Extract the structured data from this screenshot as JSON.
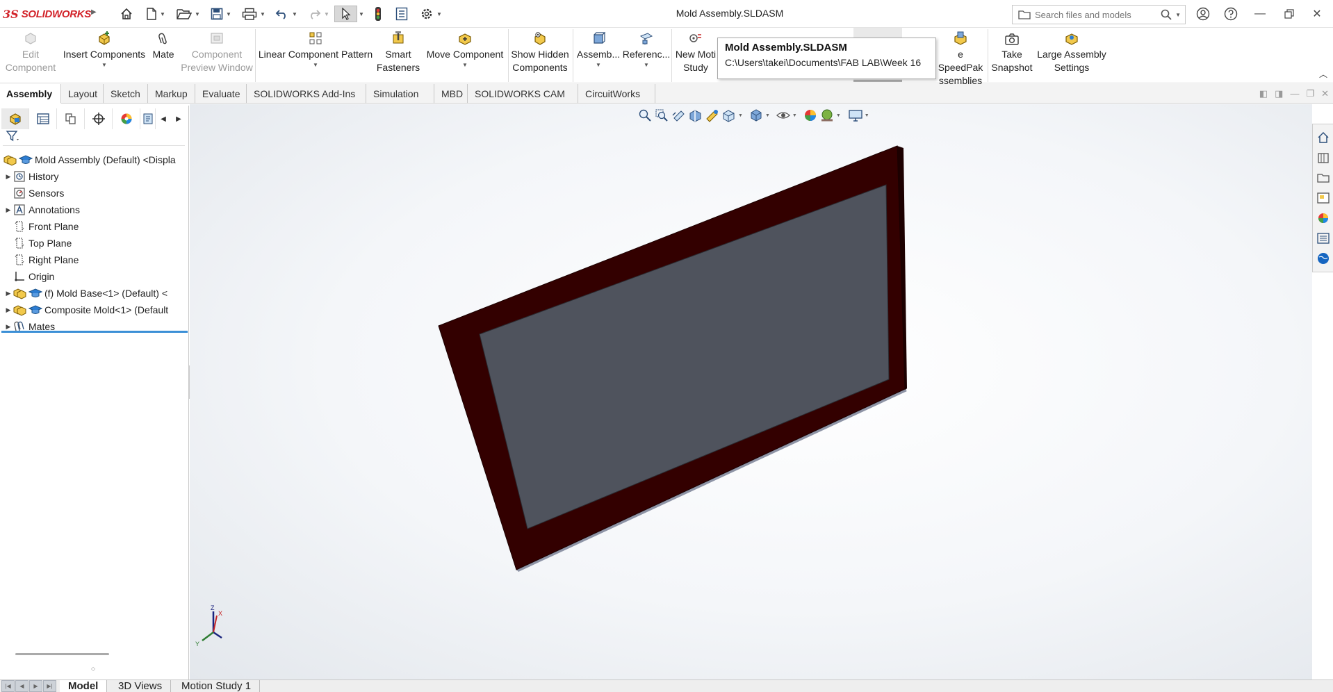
{
  "app": {
    "brand": "SOLIDWORKS"
  },
  "titlebar": {
    "document_title": "Mold Assembly.SLDASM"
  },
  "search": {
    "placeholder": "Search files and models"
  },
  "commands": {
    "edit_component": "Edit\nComponent",
    "insert_components": "Insert Components",
    "mate": "Mate",
    "component_preview": "Component\nPreview Window",
    "linear_pattern": "Linear Component Pattern",
    "smart_fasteners": "Smart\nFasteners",
    "move_component": "Move Component",
    "show_hidden": "Show Hidden\nComponents",
    "assembly": "Assemb...",
    "reference": "Referenc...",
    "new_motion": "New Moti\nStudy",
    "speedpak": "e SpeedPak\nssemblies",
    "take_snapshot": "Take\nSnapshot",
    "large_assembly": "Large Assembly\nSettings"
  },
  "tooltip": {
    "title": "Mold Assembly.SLDASM",
    "path": "C:\\Users\\takei\\Documents\\FAB LAB\\Week 16"
  },
  "tabs": [
    {
      "label": "Assembly"
    },
    {
      "label": "Layout"
    },
    {
      "label": "Sketch"
    },
    {
      "label": "Markup"
    },
    {
      "label": "Evaluate"
    },
    {
      "label": "SOLIDWORKS Add-Ins"
    },
    {
      "label": "Simulation"
    },
    {
      "label": "MBD"
    },
    {
      "label": "SOLIDWORKS CAM"
    },
    {
      "label": "CircuitWorks"
    }
  ],
  "tree": {
    "root": "Mold Assembly (Default) <Displa",
    "history": "History",
    "sensors": "Sensors",
    "annotations": "Annotations",
    "front_plane": "Front Plane",
    "top_plane": "Top Plane",
    "right_plane": "Right Plane",
    "origin": "Origin",
    "mold_base": "(f) Mold Base<1> (Default) <",
    "composite_mold": "Composite Mold<1> (Default",
    "mates": "Mates"
  },
  "triad": {
    "z": "Z",
    "x": "X",
    "y": "Y"
  },
  "bottom_tabs": [
    {
      "label": "Model"
    },
    {
      "label": "3D Views"
    },
    {
      "label": "Motion Study 1"
    }
  ],
  "colors": {
    "brand": "#d2232a",
    "frame": "#330000",
    "frame_side": "#1e0000",
    "cavity": "#4f535d",
    "selection": "#3b8fd6"
  }
}
